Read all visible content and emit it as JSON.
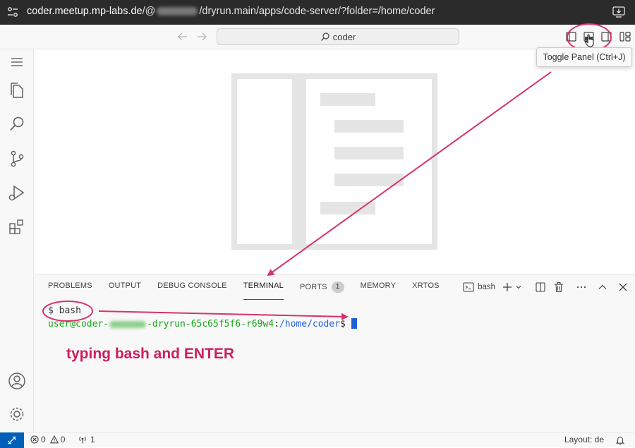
{
  "browser": {
    "url_host": "coder.meetup.mp-labs.de",
    "url_at": "/@",
    "url_rest": "/dryrun.main/apps/code-server/?folder=/home/coder",
    "icons": [
      "tune-icon",
      "install-app-icon"
    ]
  },
  "titlebar": {
    "search_text": "coder",
    "tooltip": "Toggle Panel (Ctrl+J)",
    "icons": [
      "arrow-left-icon",
      "arrow-right-icon",
      "search-icon",
      "toggle-primary-sidebar-icon",
      "toggle-panel-icon",
      "toggle-secondary-sidebar-icon",
      "customize-layout-icon"
    ]
  },
  "activity_bar": {
    "items": [
      "menu-icon",
      "explorer-icon",
      "search-icon",
      "source-control-icon",
      "run-debug-icon",
      "extensions-icon",
      "accounts-icon",
      "manage-gear-icon"
    ]
  },
  "panel": {
    "tabs": [
      {
        "label": "PROBLEMS"
      },
      {
        "label": "OUTPUT"
      },
      {
        "label": "DEBUG CONSOLE"
      },
      {
        "label": "TERMINAL",
        "active": true
      },
      {
        "label": "PORTS",
        "badge": "1"
      },
      {
        "label": "MEMORY"
      },
      {
        "label": "XRTOS"
      }
    ],
    "terminal_name": "bash",
    "terminal": {
      "line1": "$ bash",
      "prompt_user": "user@coder-",
      "prompt_host_rest": "-dryrun-65c65f5f6-r69w4",
      "prompt_sep": ":",
      "prompt_path": "/home/coder",
      "prompt_end": "$"
    },
    "annotation": "typing bash and ENTER"
  },
  "statusbar": {
    "errors": "0",
    "warnings": "0",
    "ports": "1",
    "layout": "Layout: de"
  },
  "colors": {
    "accent": "#005fb8",
    "annotation": "#cc1f5e",
    "prompt_green": "#17a317",
    "prompt_blue": "#1f5ed6"
  }
}
